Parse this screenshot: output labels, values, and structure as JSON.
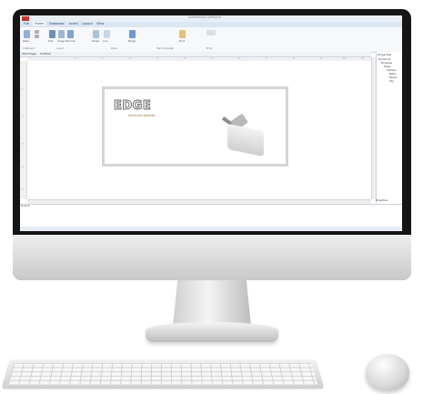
{
  "window": {
    "title": "Addressing Software"
  },
  "menu": [
    "File",
    "Home",
    "Database",
    "Insert",
    "Layout",
    "View"
  ],
  "ribbon": {
    "groups": [
      "Clipboard",
      "Insert",
      "Data",
      "Mail & Design",
      "Print"
    ],
    "buttons": [
      "Paste",
      "Cut",
      "Copy",
      "Text",
      "Image",
      "Barcode",
      "Shape",
      "Line",
      "Merge",
      "Print"
    ]
  },
  "document_tabs": [
    "Start Page",
    "Untitled"
  ],
  "rulers": {
    "top": [
      "0",
      "1",
      "2",
      "3",
      "4",
      "5",
      "6",
      "7",
      "8",
      "9",
      "10",
      "11"
    ],
    "left": [
      "1",
      "2",
      "3",
      "4",
      "5"
    ]
  },
  "envelope": {
    "brand": "EDGE",
    "brand_subtitle": "ENVELOPE PRINTER"
  },
  "panel": {
    "title": "Properties",
    "tree": [
      "Document",
      "Envelope",
      "Fields",
      "Address",
      "Name",
      "Street",
      "City"
    ],
    "bottom_tab": "Properties"
  },
  "output_label": "Output",
  "colors": {
    "accent": "#2b579a",
    "ribbon": "#f6f8fb",
    "logo": "#c0392b"
  }
}
